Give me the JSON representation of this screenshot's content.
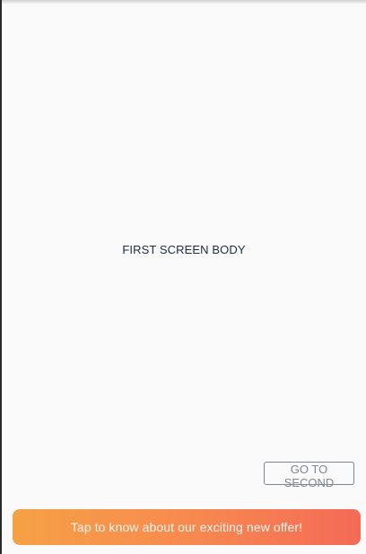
{
  "main": {
    "body_text": "FIRST SCREEN BODY"
  },
  "actions": {
    "go_to_second_label": "GO TO SECOND"
  },
  "banner": {
    "text": "Tap to know about our exciting new offer!",
    "gradient_start": "#f6a146",
    "gradient_end": "#f46a57"
  }
}
